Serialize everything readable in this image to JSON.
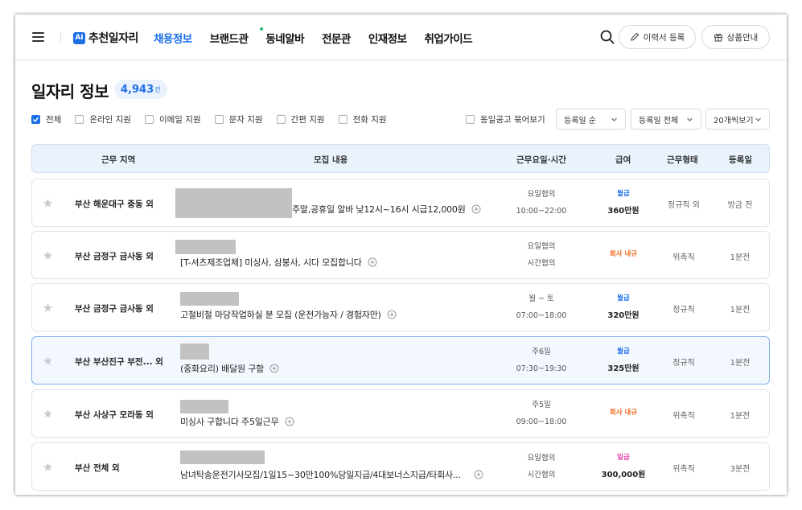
{
  "header": {
    "logo_badge": "AI",
    "logo_text": "추천일자리",
    "nav": [
      "채용정보",
      "브랜드관",
      "동네알바",
      "전문관",
      "인재정보",
      "취업가이드"
    ],
    "register_resume": "이력서 등록",
    "product_info": "상품안내"
  },
  "page": {
    "title": "일자리 정보",
    "count": "4,943",
    "count_unit": "건"
  },
  "filters": {
    "all": "전체",
    "online": "온라인 지원",
    "email": "이메일 지원",
    "sms": "문자 지원",
    "simple": "간편 지원",
    "phone": "전화 지원",
    "group_same": "동일공고 묶어보기",
    "sort": "등록일 순",
    "period": "등록일 전체",
    "per_page": "20개씩보기"
  },
  "table": {
    "headers": {
      "location": "근무 지역",
      "content": "모집 내용",
      "schedule": "근무요일·시간",
      "pay": "급여",
      "employment": "근무형태",
      "registered": "등록일"
    },
    "rows": [
      {
        "location": "부산 해운대구 중동 외",
        "content": "주말,공휴일 알바 낮12시~16시 시급12,000원",
        "sched1": "요일협의",
        "sched2": "10:00~22:00",
        "pay_type": "월급",
        "pay_color": "#1d6fe8",
        "pay_amount": "360만원",
        "employment": "정규직 외",
        "registered": "방금 전"
      },
      {
        "location": "부산 금정구 금사동 외",
        "content": "[T-셔츠제조업체] 미싱사, 삼봉사, 시다 모집합니다",
        "sched1": "요일협의",
        "sched2": "시간협의",
        "pay_type": "회사 내규",
        "pay_color": "#f06a1d",
        "pay_amount": "",
        "employment": "위촉직",
        "registered": "1분전"
      },
      {
        "location": "부산 금정구 금사동 외",
        "content": "고철비철 마당작업하실 분 모집 (운전가능자 / 경험자만)",
        "sched1": "월 ~ 토",
        "sched2": "07:00~18:00",
        "pay_type": "월급",
        "pay_color": "#1d6fe8",
        "pay_amount": "320만원",
        "employment": "정규직",
        "registered": "1분전"
      },
      {
        "location": "부산 부산진구 부전... 외",
        "content": "(중화요리) 배달원 구함",
        "sched1": "주6일",
        "sched2": "07:30~19:30",
        "pay_type": "월급",
        "pay_color": "#1d6fe8",
        "pay_amount": "325만원",
        "employment": "정규직",
        "registered": "1분전"
      },
      {
        "location": "부산 사상구 모라동 외",
        "content": "미싱사 구합니다 주5일근무",
        "sched1": "주5일",
        "sched2": "09:00~18:00",
        "pay_type": "회사 내규",
        "pay_color": "#f06a1d",
        "pay_amount": "",
        "employment": "위촉직",
        "registered": "1분전"
      },
      {
        "location": "부산 전체 외",
        "content": "남녀탁송운전기사모집/1일15~30만100%당일지급/4대보너스지급/타회사...",
        "sched1": "요일협의",
        "sched2": "시간협의",
        "pay_type": "일급",
        "pay_color": "#e83ea8",
        "pay_amount": "300,000원",
        "employment": "위촉직",
        "registered": "3분전"
      }
    ]
  },
  "icons": [
    "hamburger-icon",
    "search-icon",
    "pencil-icon",
    "gift-icon",
    "star-icon",
    "plus-circle-icon",
    "chevron-down-icon",
    "check-icon"
  ],
  "colors": {
    "accent": "#1d6fe8",
    "internal_pay": "#f06a1d",
    "daily_pay": "#e83ea8",
    "new_dot": "#19c46b"
  }
}
